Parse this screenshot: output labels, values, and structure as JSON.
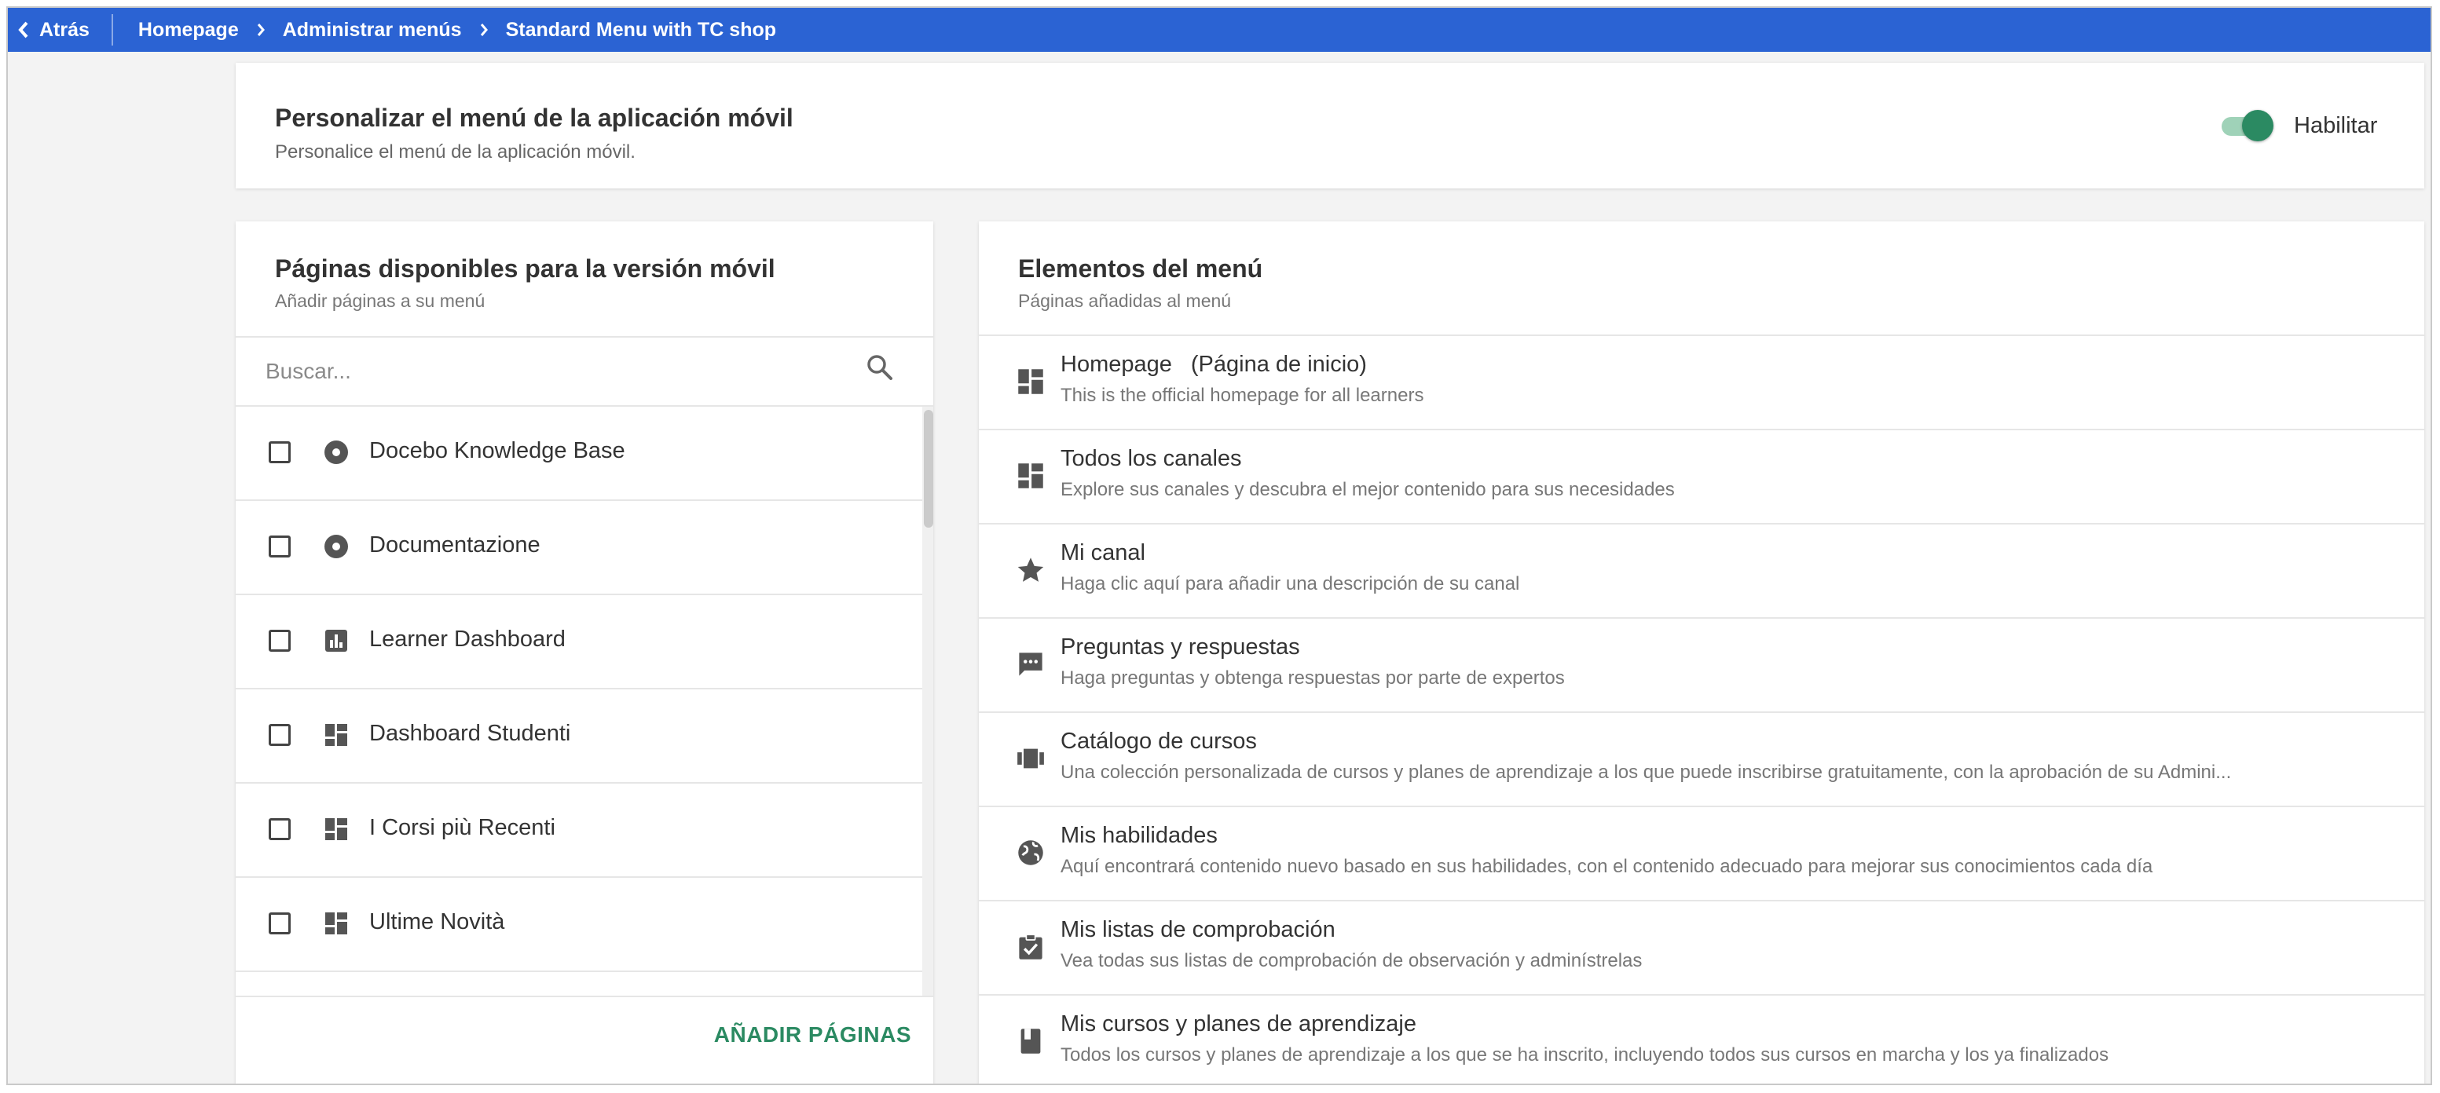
{
  "topbar": {
    "back_label": "Atrás",
    "breadcrumbs": [
      "Homepage",
      "Administrar menús",
      "Standard Menu with TC shop"
    ]
  },
  "header": {
    "title": "Personalizar el menú de la aplicación móvil",
    "subtitle": "Personalice el menú de la aplicación móvil.",
    "toggle_label": "Habilitar",
    "toggle_on": true
  },
  "available": {
    "title": "Páginas disponibles para la versión móvil",
    "subtitle": "Añadir páginas a su menú",
    "search_placeholder": "Buscar...",
    "items": [
      {
        "label": "Docebo Knowledge Base",
        "icon": "disc-icon"
      },
      {
        "label": "Documentazione",
        "icon": "disc-icon"
      },
      {
        "label": "Learner Dashboard",
        "icon": "bar-chart-icon"
      },
      {
        "label": "Dashboard Studenti",
        "icon": "dashboard-icon"
      },
      {
        "label": "I Corsi più Recenti",
        "icon": "dashboard-icon"
      },
      {
        "label": "Ultime Novità",
        "icon": "dashboard-icon"
      }
    ],
    "add_button": "AÑADIR PÁGINAS"
  },
  "menu": {
    "title": "Elementos del menú",
    "subtitle": "Páginas añadidas al menú",
    "items": [
      {
        "title": "Homepage",
        "suffix": "(Página de inicio)",
        "desc": "This is the official homepage for all learners",
        "icon": "dashboard-icon"
      },
      {
        "title": "Todos los canales",
        "suffix": "",
        "desc": "Explore sus canales y descubra el mejor contenido para sus necesidades",
        "icon": "dashboard-icon"
      },
      {
        "title": "Mi canal",
        "suffix": "",
        "desc": "Haga clic aquí para añadir una descripción de su canal",
        "icon": "star-icon"
      },
      {
        "title": "Preguntas y respuestas",
        "suffix": "",
        "desc": "Haga preguntas y obtenga respuestas por parte de expertos",
        "icon": "chat-icon"
      },
      {
        "title": "Catálogo de cursos",
        "suffix": "",
        "desc": "Una colección personalizada de cursos y planes de aprendizaje a los que puede inscribirse gratuitamente, con la aprobación de su Admini...",
        "icon": "catalog-icon"
      },
      {
        "title": "Mis habilidades",
        "suffix": "",
        "desc": "Aquí encontrará contenido nuevo basado en sus habilidades, con el contenido adecuado para mejorar sus conocimientos cada día",
        "icon": "globe-icon"
      },
      {
        "title": "Mis listas de comprobación",
        "suffix": "",
        "desc": "Vea todas sus listas de comprobación de observación y adminístrelas",
        "icon": "checklist-icon"
      },
      {
        "title": "Mis cursos y planes de aprendizaje",
        "suffix": "",
        "desc": "Todos los cursos y planes de aprendizaje a los que se ha inscrito, incluyendo todos sus cursos en marcha y los ya finalizados",
        "icon": "book-icon"
      }
    ]
  },
  "colors": {
    "topbar": "#2b63d3",
    "accent_green": "#2b8a62",
    "toggle_track": "#9fd2b8"
  }
}
